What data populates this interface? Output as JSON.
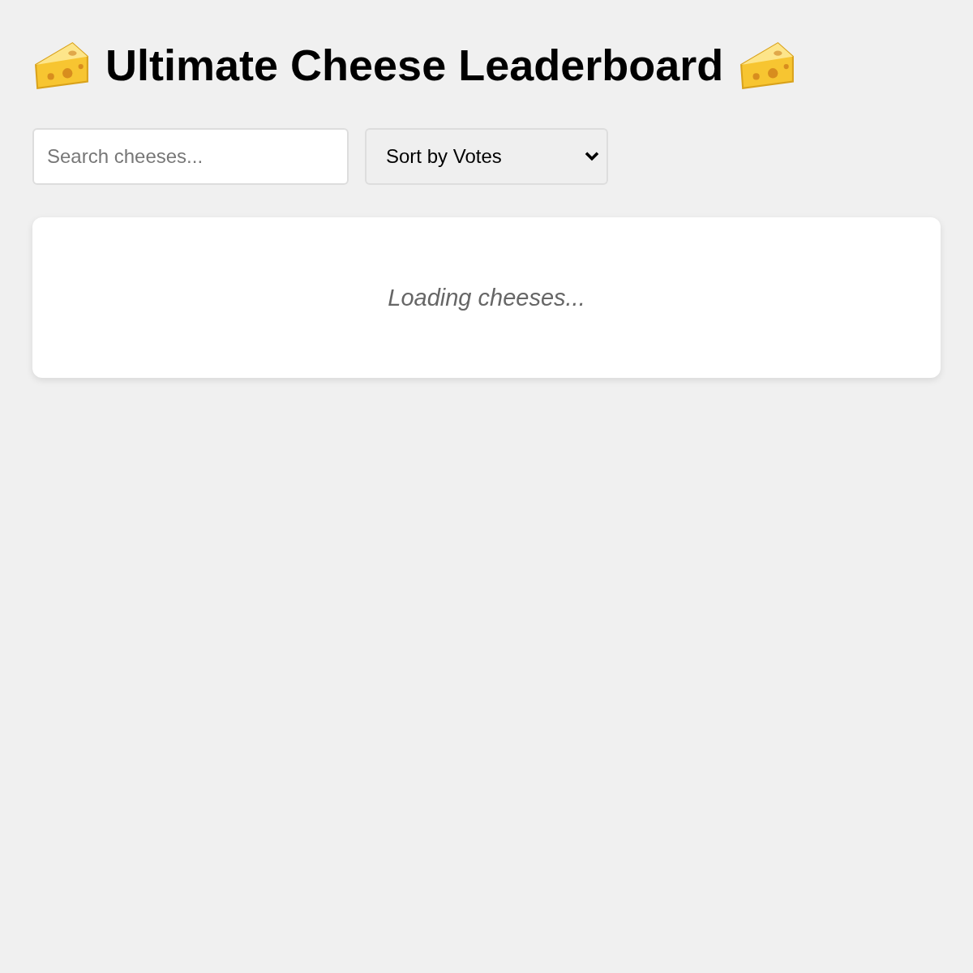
{
  "title": "Ultimate Cheese Leaderboard",
  "search": {
    "placeholder": "Search cheeses..."
  },
  "sort": {
    "value": "Sort by Votes"
  },
  "status": {
    "message": "Loading cheeses..."
  }
}
